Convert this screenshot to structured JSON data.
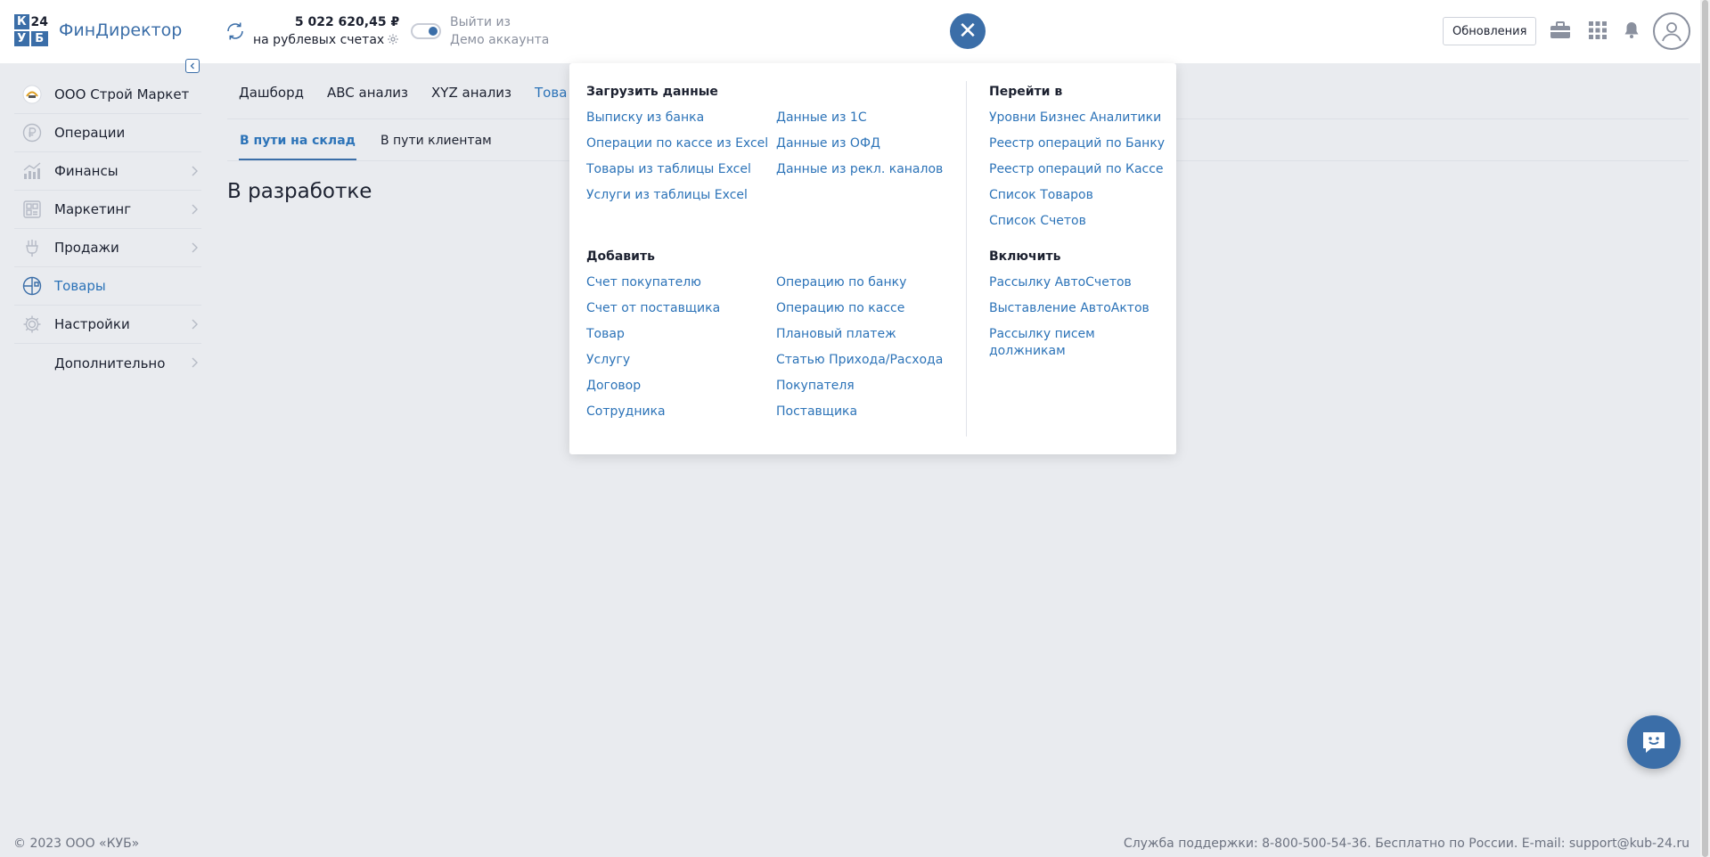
{
  "header": {
    "logo": {
      "top_left": "К",
      "top_right": "24",
      "bottom_left": "У",
      "bottom_right": "Б",
      "name": "ФинДиректор"
    },
    "balance": {
      "amount": "5 022 620,45 ₽",
      "label": "на рублевых счетах"
    },
    "demo": {
      "line1": "Выйти из",
      "line2": "Демо аккаунта"
    },
    "close_symbol": "✕",
    "updates_label": "Обновления"
  },
  "sidebar": {
    "items": [
      {
        "label": "ООО Строй Маркет",
        "icon": "company-logo-icon",
        "chevron": false
      },
      {
        "label": "Операции",
        "icon": "ruble-icon",
        "chevron": false
      },
      {
        "label": "Финансы",
        "icon": "chart-icon",
        "chevron": true
      },
      {
        "label": "Маркетинг",
        "icon": "marketing-icon",
        "chevron": true
      },
      {
        "label": "Продажи",
        "icon": "handshake-icon",
        "chevron": true
      },
      {
        "label": "Товары",
        "icon": "goods-icon",
        "chevron": false,
        "active": true
      },
      {
        "label": "Настройки",
        "icon": "gear-icon",
        "chevron": true
      },
      {
        "label": "Дополнительно",
        "icon": "",
        "chevron": true
      }
    ]
  },
  "main": {
    "tabs": [
      "Дашборд",
      "ABC анализ",
      "XYZ анализ",
      "Това"
    ],
    "subtabs": [
      "В пути на склад",
      "В пути клиентам"
    ],
    "title": "В разработке"
  },
  "panel": {
    "load": {
      "title": "Загрузить данные",
      "col1": [
        "Выписку из банка",
        "Операции по кассе из Excel",
        "Товары из таблицы Excel",
        "Услуги из таблицы Excel"
      ],
      "col2": [
        "Данные из 1С",
        "Данные из ОФД",
        "Данные из рекл. каналов"
      ]
    },
    "add": {
      "title": "Добавить",
      "col1": [
        "Счет покупателю",
        "Счет от поставщика",
        "Товар",
        "Услугу",
        "Договор",
        "Сотрудника"
      ],
      "col2": [
        "Операцию по банку",
        "Операцию по кассе",
        "Плановый платеж",
        "Статью Прихода/Расхода",
        "Покупателя",
        "Поставщика"
      ]
    },
    "goto": {
      "title": "Перейти в",
      "items": [
        "Уровни Бизнес Аналитики",
        "Реестр операций по Банку",
        "Реестр операций по Кассе",
        "Список Товаров",
        "Список Счетов"
      ]
    },
    "enable": {
      "title": "Включить",
      "items": [
        "Рассылку АвтоСчетов",
        "Выставление АвтоАктов",
        "Рассылку писем должникам"
      ]
    }
  },
  "footer": {
    "copyright": "© 2023 ООО «КУБ»",
    "support": "Служба поддержки: 8-800-500-54-36. Бесплатно по России. E-mail: support@kub-24.ru"
  },
  "colors": {
    "accent": "#3b6ea8",
    "link": "#2c73b8",
    "background": "#e9ebef"
  }
}
